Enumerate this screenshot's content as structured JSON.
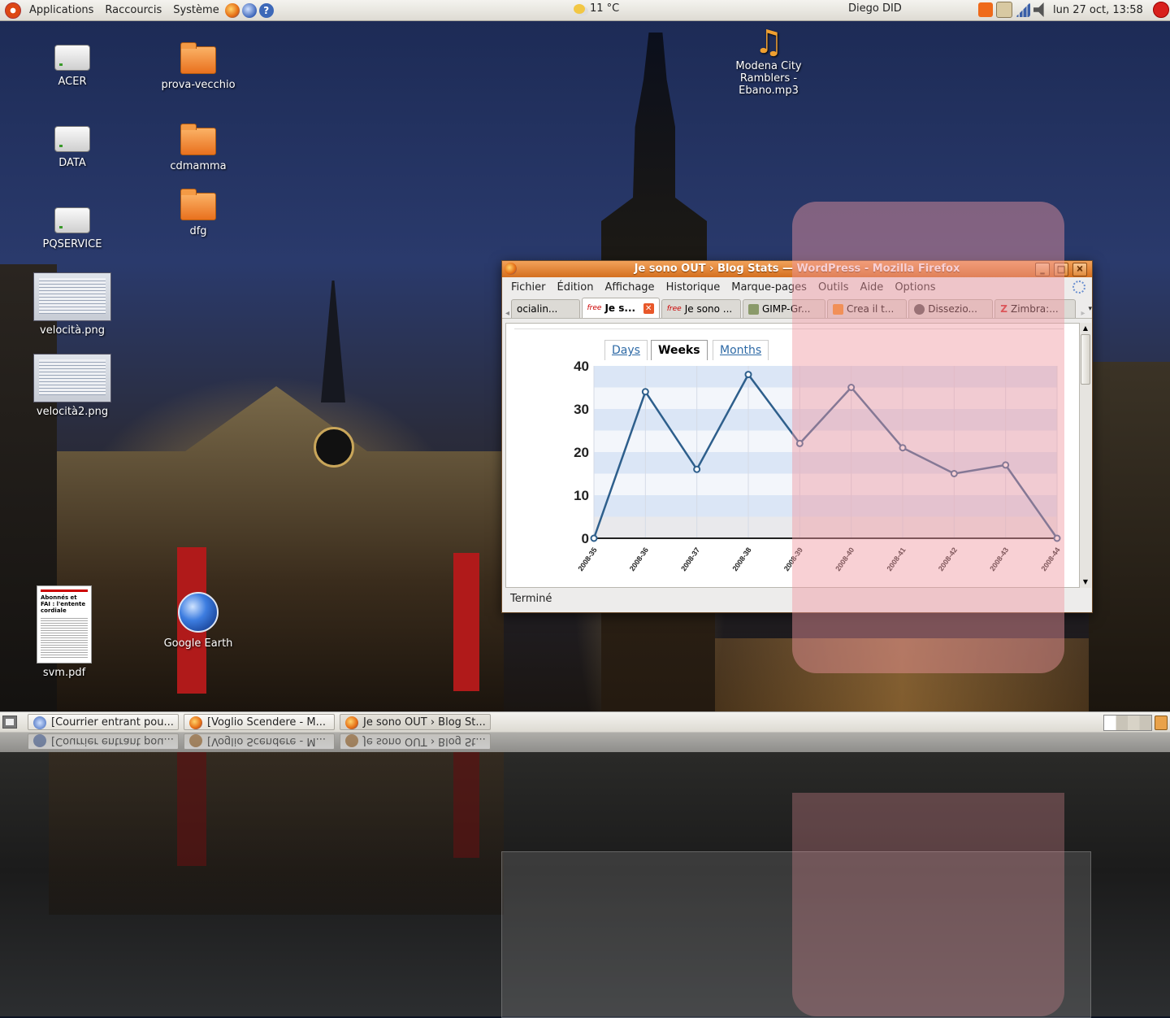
{
  "top_panel": {
    "applications": "Applications",
    "shortcuts": "Raccourcis",
    "system": "Système",
    "weather": "11 °C",
    "user": "Diego DID",
    "datetime": "lun 27 oct, 13:58"
  },
  "desktop_icons": {
    "acer": "ACER",
    "data": "DATA",
    "pqservice": "PQSERVICE",
    "velocita": "velocità.png",
    "velocita2": "velocità2.png",
    "svm": "svm.pdf",
    "prova": "prova-vecchio",
    "cdmamma": "cdmamma",
    "dfg": "dfg",
    "google_earth": "Google Earth",
    "mp3": "Modena City Ramblers - Ebano.mp3",
    "pdf_headline": "Abonnés et FAI : l'entente cordiale"
  },
  "firefox": {
    "title": "Je sono OUT › Blog Stats — WordPress - Mozilla Firefox",
    "menu": {
      "file": "Fichier",
      "edit": "Édition",
      "view": "Affichage",
      "history": "Historique",
      "bookmarks": "Marque-pages",
      "tools": "Outils",
      "help": "Aide",
      "options": "Options"
    },
    "tabs": [
      "ocialin...",
      "Je s...",
      "Je sono ...",
      "GIMP-Gr...",
      "Crea il t...",
      "Dissezio...",
      "Zimbra:..."
    ],
    "periods": {
      "days": "Days",
      "weeks": "Weeks",
      "months": "Months"
    },
    "status": "Terminé"
  },
  "taskbar": {
    "tasks": [
      "[Courrier entrant pou...",
      "[Voglio Scendere - M...",
      "Je sono OUT › Blog St..."
    ]
  },
  "chart_data": {
    "type": "line",
    "categories": [
      "2008-35",
      "2008-36",
      "2008-37",
      "2008-38",
      "2008-39",
      "2008-40",
      "2008-41",
      "2008-42",
      "2008-43",
      "2008-44"
    ],
    "values": [
      0,
      34,
      16,
      38,
      22,
      35,
      21,
      15,
      17,
      0
    ],
    "yticks": [
      0,
      10,
      20,
      30,
      40
    ],
    "ylim": [
      0,
      40
    ],
    "color": "#2e5f8c"
  }
}
